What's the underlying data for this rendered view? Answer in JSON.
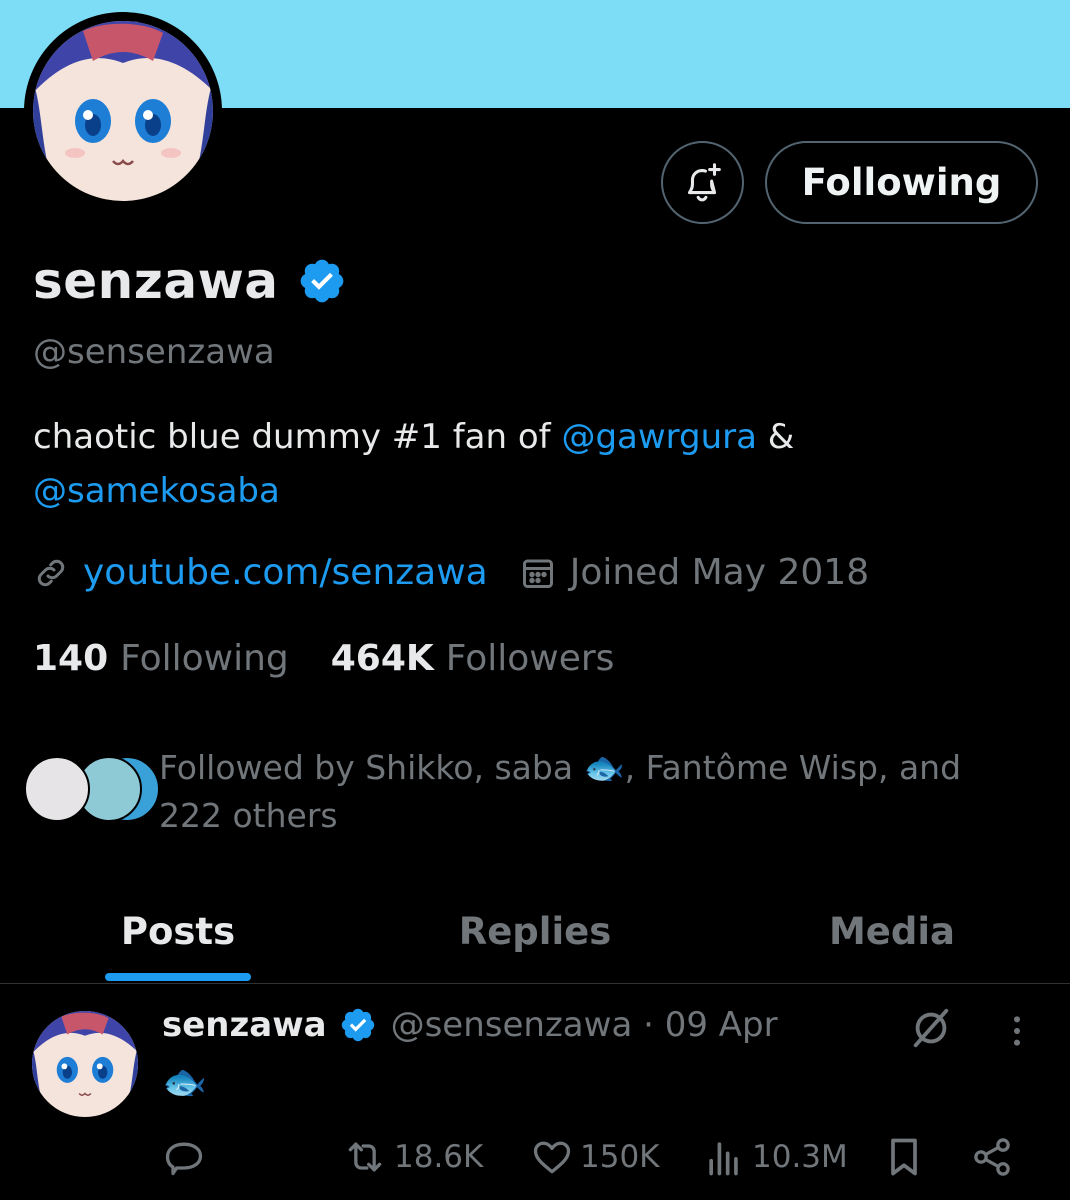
{
  "profile": {
    "display_name": "senzawa",
    "handle": "@sensenzawa",
    "bio_text": "chaotic blue dummy #1 fan of ",
    "bio_mention_1": "@gawrgura",
    "bio_amp": " &",
    "bio_mention_2": "@samekosaba",
    "website": "youtube.com/senzawa",
    "joined": "Joined May 2018",
    "following_count": "140",
    "following_label": "Following",
    "followers_count": "464K",
    "followers_label": "Followers",
    "followed_by": "Followed by Shikko, saba 🐟, Fantôme Wisp, and 222 others"
  },
  "actions": {
    "follow_button": "Following"
  },
  "tabs": [
    {
      "label": "Posts",
      "active": true
    },
    {
      "label": "Replies",
      "active": false
    },
    {
      "label": "Media",
      "active": false
    }
  ],
  "post": {
    "name": "senzawa",
    "handle_date": "@sensenzawa · 09 Apr",
    "body": "🐟",
    "reposts": "18.6K",
    "likes": "150K",
    "views": "10.3M"
  },
  "colors": {
    "banner": "#7ddcf6",
    "accent": "#1d9bf0",
    "background": "#000000",
    "muted": "#71767b"
  },
  "icons": [
    "bell-plus-icon",
    "verified-badge-icon",
    "link-icon",
    "calendar-icon",
    "grok-icon",
    "more-icon",
    "reply-icon",
    "repost-icon",
    "like-icon",
    "views-icon",
    "bookmark-icon",
    "share-icon"
  ]
}
